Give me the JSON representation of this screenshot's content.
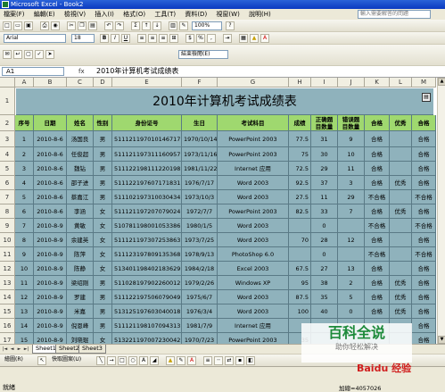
{
  "window": {
    "title": "Microsoft Excel - Book2"
  },
  "menu": {
    "items": [
      "檔案(F)",
      "編輯(E)",
      "檢視(V)",
      "插入(I)",
      "格式(O)",
      "工具(T)",
      "資料(D)",
      "視窗(W)",
      "說明(H)"
    ],
    "help_placeholder": "輸入需要解答的問題"
  },
  "toolbar": {
    "zoom": "100%",
    "font": "Arial",
    "size": "18",
    "review_label": "結束檢閱(E)"
  },
  "formula_bar": {
    "name_box": "A1",
    "fx": "fx",
    "content": "2010年计算机考试成绩表"
  },
  "columns": [
    "A",
    "B",
    "C",
    "D",
    "E",
    "F",
    "G",
    "H",
    "I",
    "J",
    "K",
    "L",
    "M"
  ],
  "rows": [
    "1",
    "2",
    "3",
    "4",
    "5",
    "6",
    "7",
    "8",
    "9",
    "10",
    "11",
    "12",
    "13",
    "14",
    "15",
    "16",
    "17"
  ],
  "sheet": {
    "title": "2010年计算机考试成绩表",
    "headers": [
      "序号",
      "日期",
      "姓名",
      "性别",
      "身份证号",
      "生日",
      "考试科目",
      "成绩",
      "正确题目数量",
      "错误题目数量",
      "合格",
      "优秀",
      "合格"
    ],
    "data": [
      [
        "1",
        "2010-8-6",
        "汤国良",
        "男",
        "511121197010146717",
        "1970/10/14",
        "PowerPoint 2003",
        "77.5",
        "31",
        "9",
        "合格",
        "",
        "合格"
      ],
      [
        "2",
        "2010-8-6",
        "任俊超",
        "男",
        "511121197311160957",
        "1973/11/16",
        "PowerPoint 2003",
        "75",
        "30",
        "10",
        "合格",
        "",
        "合格"
      ],
      [
        "3",
        "2010-8-6",
        "魏钻",
        "男",
        "511122198111220198",
        "1981/11/22",
        "Internet 应用",
        "72.5",
        "29",
        "11",
        "合格",
        "",
        "合格"
      ],
      [
        "4",
        "2010-8-6",
        "邵子进",
        "男",
        "511122197607171831",
        "1976/7/17",
        "Word 2003",
        "92.5",
        "37",
        "3",
        "合格",
        "优秀",
        "合格"
      ],
      [
        "5",
        "2010-8-6",
        "蔡嘉江",
        "男",
        "511102197310030434",
        "1973/10/3",
        "Word 2003",
        "27.5",
        "11",
        "29",
        "不合格",
        "",
        "不合格"
      ],
      [
        "6",
        "2010-8-6",
        "李涵",
        "女",
        "511121197207079024",
        "1972/7/7",
        "PowerPoint 2003",
        "82.5",
        "33",
        "7",
        "合格",
        "优秀",
        "合格"
      ],
      [
        "7",
        "2010-8-9",
        "黄敏",
        "女",
        "510781198001053386",
        "1980/1/5",
        "Word 2003",
        "",
        "0",
        "",
        "不合格",
        "",
        "不合格"
      ],
      [
        "8",
        "2010-8-9",
        "余建英",
        "女",
        "511121197307253863",
        "1973/7/25",
        "Word 2003",
        "70",
        "28",
        "12",
        "合格",
        "",
        "合格"
      ],
      [
        "9",
        "2010-8-9",
        "陈萍",
        "女",
        "511123197809135368",
        "1978/9/13",
        "PhotoShop 6.0",
        "",
        "0",
        "",
        "不合格",
        "",
        "不合格"
      ],
      [
        "10",
        "2010-8-9",
        "陈静",
        "女",
        "513401198402183629",
        "1984/2/18",
        "Excel 2003",
        "67.5",
        "27",
        "13",
        "合格",
        "",
        "合格"
      ],
      [
        "11",
        "2010-8-9",
        "梁绍刚",
        "男",
        "511028197902260012",
        "1979/2/26",
        "Windows XP",
        "95",
        "38",
        "2",
        "合格",
        "优秀",
        "合格"
      ],
      [
        "12",
        "2010-8-9",
        "罗建",
        "男",
        "511122197506079049",
        "1975/6/7",
        "Word 2003",
        "87.5",
        "35",
        "5",
        "合格",
        "优秀",
        "合格"
      ],
      [
        "13",
        "2010-8-9",
        "米嘉",
        "男",
        "513125197603040018",
        "1976/3/4",
        "Word 2003",
        "100",
        "40",
        "0",
        "合格",
        "优秀",
        "合格"
      ],
      [
        "14",
        "2010-8-9",
        "倪恩峰",
        "男",
        "511121198107094313",
        "1981/7/9",
        "Internet 应用",
        "",
        "",
        "",
        "",
        "",
        "合格"
      ],
      [
        "15",
        "2010-8-9",
        "刘晓琨",
        "女",
        "513221197007230042",
        "1970/7/23",
        "PowerPoint 2003",
        "35",
        "",
        "",
        "",
        "",
        "合格"
      ]
    ]
  },
  "sheet_tabs": [
    "Sheet1",
    "Sheet2",
    "Sheet3"
  ],
  "drawing_toolbar": {
    "draw_label": "繪圖(R)",
    "autoshapes_label": "快取圖案(U)"
  },
  "status": {
    "ready": "就緒",
    "sum": "加總=4057026"
  },
  "watermark": {
    "main": "百科全说",
    "sub": "助你轻松解决",
    "brand": "Baidu 经验"
  }
}
